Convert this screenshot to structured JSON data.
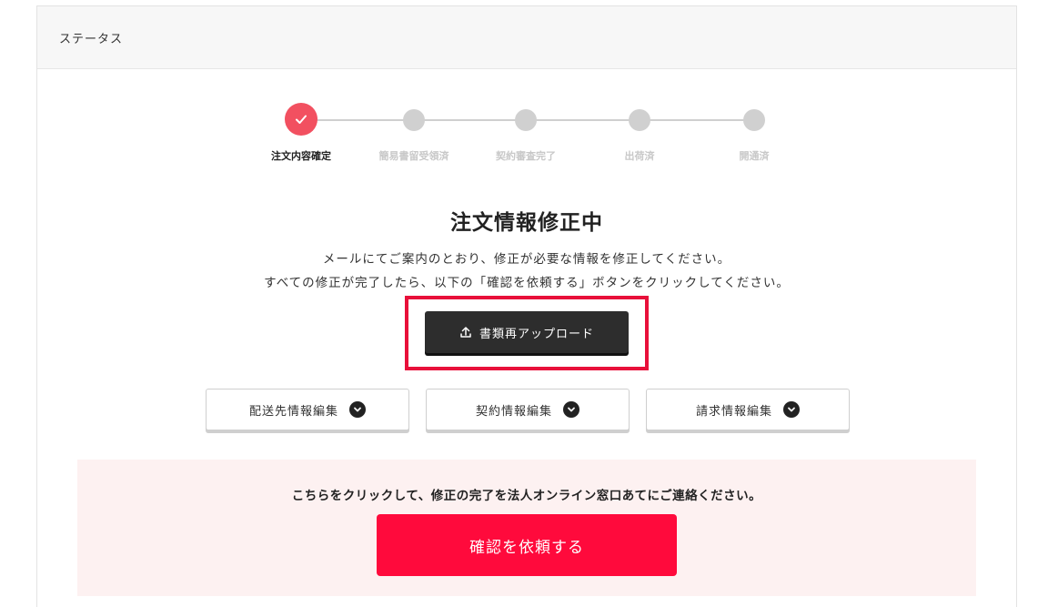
{
  "header": {
    "title": "ステータス"
  },
  "stepper": {
    "steps": [
      {
        "label": "注文内容確定",
        "state": "done"
      },
      {
        "label": "簡易書留受領済",
        "state": "pending"
      },
      {
        "label": "契約審査完了",
        "state": "pending"
      },
      {
        "label": "出荷済",
        "state": "pending"
      },
      {
        "label": "開通済",
        "state": "pending"
      }
    ]
  },
  "main": {
    "title": "注文情報修正中",
    "desc_line1": "メールにてご案内のとおり、修正が必要な情報を修正してください。",
    "desc_line2": "すべての修正が完了したら、以下の「確認を依頼する」ボタンをクリックしてください。",
    "upload_label": "書類再アップロード"
  },
  "edit_buttons": [
    {
      "label": "配送先情報編集",
      "icon": "chevron-down-icon"
    },
    {
      "label": "契約情報編集",
      "icon": "chevron-down-icon"
    },
    {
      "label": "請求情報編集",
      "icon": "chevron-down-icon"
    }
  ],
  "notice": {
    "text": "こちらをクリックして、修正の完了を法人オンライン窓口あてにご連絡ください。",
    "request_label": "確認を依頼する"
  },
  "colors": {
    "accent": "#f25060",
    "request": "#ff0a3c",
    "highlight": "#e8103a",
    "dark_button": "#2d2d2d",
    "notice_bg": "#fdf1f1"
  }
}
